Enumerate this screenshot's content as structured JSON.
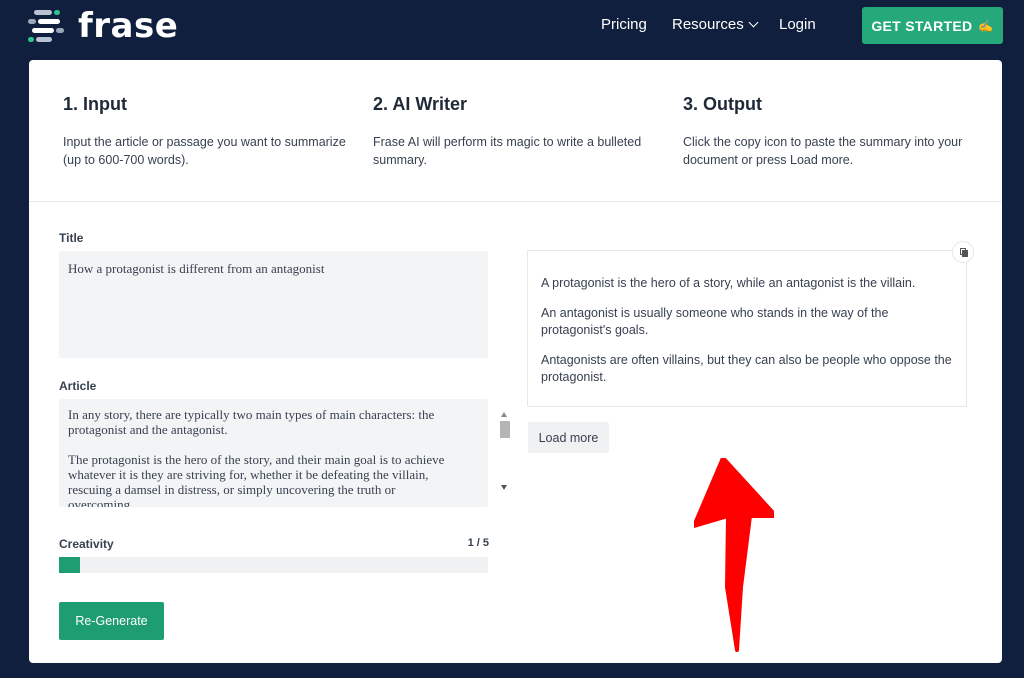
{
  "header": {
    "logo_text": "frase",
    "nav": {
      "pricing": "Pricing",
      "resources": "Resources",
      "login": "Login"
    },
    "cta_label": "GET STARTED",
    "cta_icon": "✍"
  },
  "steps": [
    {
      "title": "1. Input",
      "desc": "Input the article or passage you want to summarize (up to 600-700 words)."
    },
    {
      "title": "2. AI Writer",
      "desc": "Frase AI will perform its magic to write a bulleted summary."
    },
    {
      "title": "3. Output",
      "desc": "Click the copy icon to paste the summary into your document or press Load more."
    }
  ],
  "form": {
    "title_label": "Title",
    "title_value": "How a protagonist is different from an antagonist",
    "article_label": "Article",
    "article_paragraphs": [
      "In any story, there are typically two main types of main characters: the protagonist and the antagonist.",
      "The protagonist is the hero of the story, and their main goal is to achieve whatever it is they are striving for, whether it be defeating the villain, rescuing a damsel in distress, or simply uncovering the truth or overcoming"
    ],
    "creativity_label": "Creativity",
    "creativity_count": "1 / 5",
    "creativity_value": 1,
    "creativity_max": 5,
    "regenerate_label": "Re-Generate"
  },
  "output": {
    "bullets": [
      "A protagonist is the hero of a story, while an antagonist is the villain.",
      "An antagonist is usually someone who stands in the way of the protagonist's goals.",
      "Antagonists are often villains, but they can also be people who oppose the protagonist."
    ],
    "load_more_label": "Load more"
  },
  "colors": {
    "background": "#0f1f3d",
    "accent": "#26a97a",
    "annotation_arrow": "#ff0000"
  }
}
